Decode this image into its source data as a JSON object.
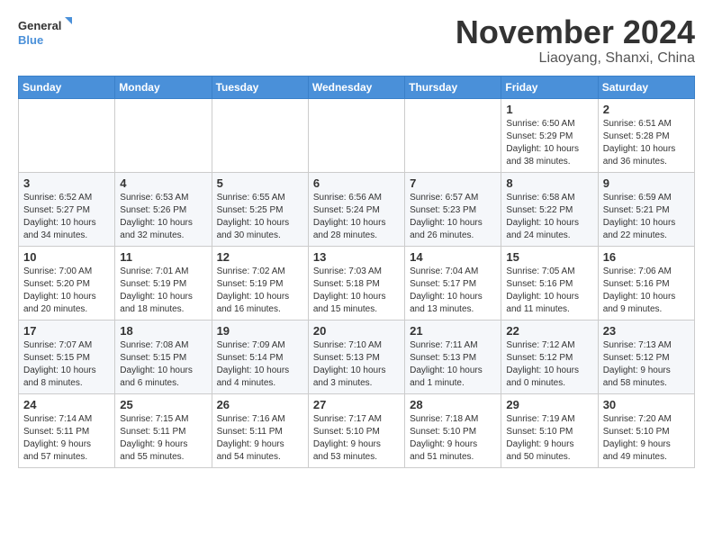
{
  "logo": {
    "line1": "General",
    "line2": "Blue"
  },
  "title": "November 2024",
  "location": "Liaoyang, Shanxi, China",
  "weekdays": [
    "Sunday",
    "Monday",
    "Tuesday",
    "Wednesday",
    "Thursday",
    "Friday",
    "Saturday"
  ],
  "weeks": [
    [
      {
        "day": "",
        "info": ""
      },
      {
        "day": "",
        "info": ""
      },
      {
        "day": "",
        "info": ""
      },
      {
        "day": "",
        "info": ""
      },
      {
        "day": "",
        "info": ""
      },
      {
        "day": "1",
        "info": "Sunrise: 6:50 AM\nSunset: 5:29 PM\nDaylight: 10 hours\nand 38 minutes."
      },
      {
        "day": "2",
        "info": "Sunrise: 6:51 AM\nSunset: 5:28 PM\nDaylight: 10 hours\nand 36 minutes."
      }
    ],
    [
      {
        "day": "3",
        "info": "Sunrise: 6:52 AM\nSunset: 5:27 PM\nDaylight: 10 hours\nand 34 minutes."
      },
      {
        "day": "4",
        "info": "Sunrise: 6:53 AM\nSunset: 5:26 PM\nDaylight: 10 hours\nand 32 minutes."
      },
      {
        "day": "5",
        "info": "Sunrise: 6:55 AM\nSunset: 5:25 PM\nDaylight: 10 hours\nand 30 minutes."
      },
      {
        "day": "6",
        "info": "Sunrise: 6:56 AM\nSunset: 5:24 PM\nDaylight: 10 hours\nand 28 minutes."
      },
      {
        "day": "7",
        "info": "Sunrise: 6:57 AM\nSunset: 5:23 PM\nDaylight: 10 hours\nand 26 minutes."
      },
      {
        "day": "8",
        "info": "Sunrise: 6:58 AM\nSunset: 5:22 PM\nDaylight: 10 hours\nand 24 minutes."
      },
      {
        "day": "9",
        "info": "Sunrise: 6:59 AM\nSunset: 5:21 PM\nDaylight: 10 hours\nand 22 minutes."
      }
    ],
    [
      {
        "day": "10",
        "info": "Sunrise: 7:00 AM\nSunset: 5:20 PM\nDaylight: 10 hours\nand 20 minutes."
      },
      {
        "day": "11",
        "info": "Sunrise: 7:01 AM\nSunset: 5:19 PM\nDaylight: 10 hours\nand 18 minutes."
      },
      {
        "day": "12",
        "info": "Sunrise: 7:02 AM\nSunset: 5:19 PM\nDaylight: 10 hours\nand 16 minutes."
      },
      {
        "day": "13",
        "info": "Sunrise: 7:03 AM\nSunset: 5:18 PM\nDaylight: 10 hours\nand 15 minutes."
      },
      {
        "day": "14",
        "info": "Sunrise: 7:04 AM\nSunset: 5:17 PM\nDaylight: 10 hours\nand 13 minutes."
      },
      {
        "day": "15",
        "info": "Sunrise: 7:05 AM\nSunset: 5:16 PM\nDaylight: 10 hours\nand 11 minutes."
      },
      {
        "day": "16",
        "info": "Sunrise: 7:06 AM\nSunset: 5:16 PM\nDaylight: 10 hours\nand 9 minutes."
      }
    ],
    [
      {
        "day": "17",
        "info": "Sunrise: 7:07 AM\nSunset: 5:15 PM\nDaylight: 10 hours\nand 8 minutes."
      },
      {
        "day": "18",
        "info": "Sunrise: 7:08 AM\nSunset: 5:15 PM\nDaylight: 10 hours\nand 6 minutes."
      },
      {
        "day": "19",
        "info": "Sunrise: 7:09 AM\nSunset: 5:14 PM\nDaylight: 10 hours\nand 4 minutes."
      },
      {
        "day": "20",
        "info": "Sunrise: 7:10 AM\nSunset: 5:13 PM\nDaylight: 10 hours\nand 3 minutes."
      },
      {
        "day": "21",
        "info": "Sunrise: 7:11 AM\nSunset: 5:13 PM\nDaylight: 10 hours\nand 1 minute."
      },
      {
        "day": "22",
        "info": "Sunrise: 7:12 AM\nSunset: 5:12 PM\nDaylight: 10 hours\nand 0 minutes."
      },
      {
        "day": "23",
        "info": "Sunrise: 7:13 AM\nSunset: 5:12 PM\nDaylight: 9 hours\nand 58 minutes."
      }
    ],
    [
      {
        "day": "24",
        "info": "Sunrise: 7:14 AM\nSunset: 5:11 PM\nDaylight: 9 hours\nand 57 minutes."
      },
      {
        "day": "25",
        "info": "Sunrise: 7:15 AM\nSunset: 5:11 PM\nDaylight: 9 hours\nand 55 minutes."
      },
      {
        "day": "26",
        "info": "Sunrise: 7:16 AM\nSunset: 5:11 PM\nDaylight: 9 hours\nand 54 minutes."
      },
      {
        "day": "27",
        "info": "Sunrise: 7:17 AM\nSunset: 5:10 PM\nDaylight: 9 hours\nand 53 minutes."
      },
      {
        "day": "28",
        "info": "Sunrise: 7:18 AM\nSunset: 5:10 PM\nDaylight: 9 hours\nand 51 minutes."
      },
      {
        "day": "29",
        "info": "Sunrise: 7:19 AM\nSunset: 5:10 PM\nDaylight: 9 hours\nand 50 minutes."
      },
      {
        "day": "30",
        "info": "Sunrise: 7:20 AM\nSunset: 5:10 PM\nDaylight: 9 hours\nand 49 minutes."
      }
    ]
  ]
}
